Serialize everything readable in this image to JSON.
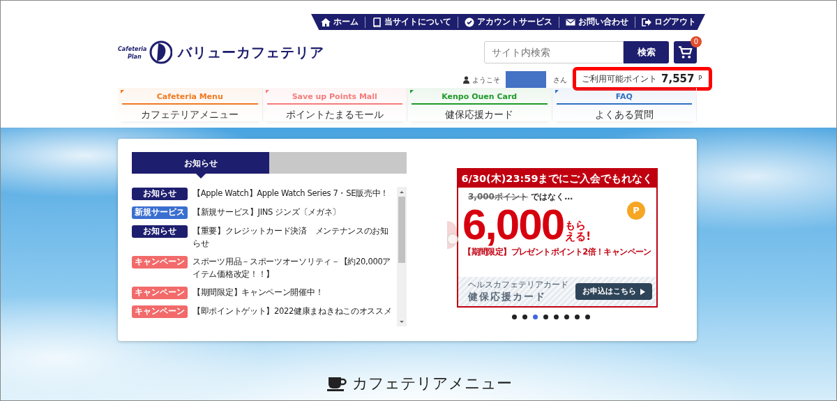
{
  "top_nav": [
    {
      "label": "ホーム"
    },
    {
      "label": "当サイトについて"
    },
    {
      "label": "アカウントサービス"
    },
    {
      "label": "お問い合わせ"
    },
    {
      "label": "ログアウト"
    }
  ],
  "logo": {
    "mark_line1": "Cafeteria",
    "mark_line2": "Plan",
    "title": "バリューカフェテリア"
  },
  "search": {
    "placeholder": "サイト内検索",
    "button": "検索"
  },
  "cart": {
    "count": "0"
  },
  "welcome": {
    "prefix": "ようこそ",
    "suffix": "さん"
  },
  "points": {
    "label": "ご利用可能ポイント",
    "value": "7,557",
    "unit": "P"
  },
  "categories": [
    {
      "english": "Cafeteria Menu",
      "label": "カフェテリアメニュー",
      "color": "#f07a22"
    },
    {
      "english": "Save up Points Mall",
      "label": "ポイントたまるモール",
      "color": "#f47c7c"
    },
    {
      "english": "Kenpo Ouen Card",
      "label": "健保応援カード",
      "color": "#1f9a2a"
    },
    {
      "english": "FAQ",
      "label": "よくある質問",
      "color": "#2f6fc4"
    }
  ],
  "news_tabs": [
    {
      "label": "お知らせ",
      "selected": true
    },
    {
      "selected": false
    }
  ],
  "news": [
    {
      "tag": "お知らせ",
      "color": "#1e1e6e",
      "title": "【Apple Watch】Apple Watch Series 7・SE販売中！"
    },
    {
      "tag": "新規サービス",
      "color": "#3a6fd0",
      "title": "【新規サービス】JINS ジンズ〔メガネ〕"
    },
    {
      "tag": "お知らせ",
      "color": "#1e1e6e",
      "title": "【重要】クレジットカード決済　メンテナンスのお知らせ"
    },
    {
      "tag": "キャンペーン",
      "color": "#f26a6a",
      "title": "スポーツ用品－スポーツオーソリティ－【約20,000アイテム価格改定！！】"
    },
    {
      "tag": "キャンペーン",
      "color": "#f26a6a",
      "title": "【期間限定】キャンペーン開催中！"
    },
    {
      "tag": "キャンペーン",
      "color": "#f26a6a",
      "title": "【即ポイントゲット】2022健康まねきねこのオススメ"
    }
  ],
  "banner": {
    "headline": "6/30(木)23:59までにご入会でもれなく",
    "old_points": "3,000ポイント",
    "not_text": "ではなく…",
    "big_number": "6,000",
    "coin": "P",
    "get_line1": "もら",
    "get_line2": "える!",
    "campaign": "【期間限定】プレゼントポイント2倍！キャンペーン",
    "card_small": "ヘルスカフェテリアカード",
    "card_name": "健保応援カード",
    "apply": "お申込はこちら"
  },
  "carousel_dots": [
    {
      "selected": false
    },
    {
      "selected": false
    },
    {
      "selected": true
    },
    {
      "selected": false
    },
    {
      "selected": false
    },
    {
      "selected": false
    },
    {
      "selected": false
    },
    {
      "selected": false
    }
  ],
  "section_heading": "カフェテリアメニュー"
}
